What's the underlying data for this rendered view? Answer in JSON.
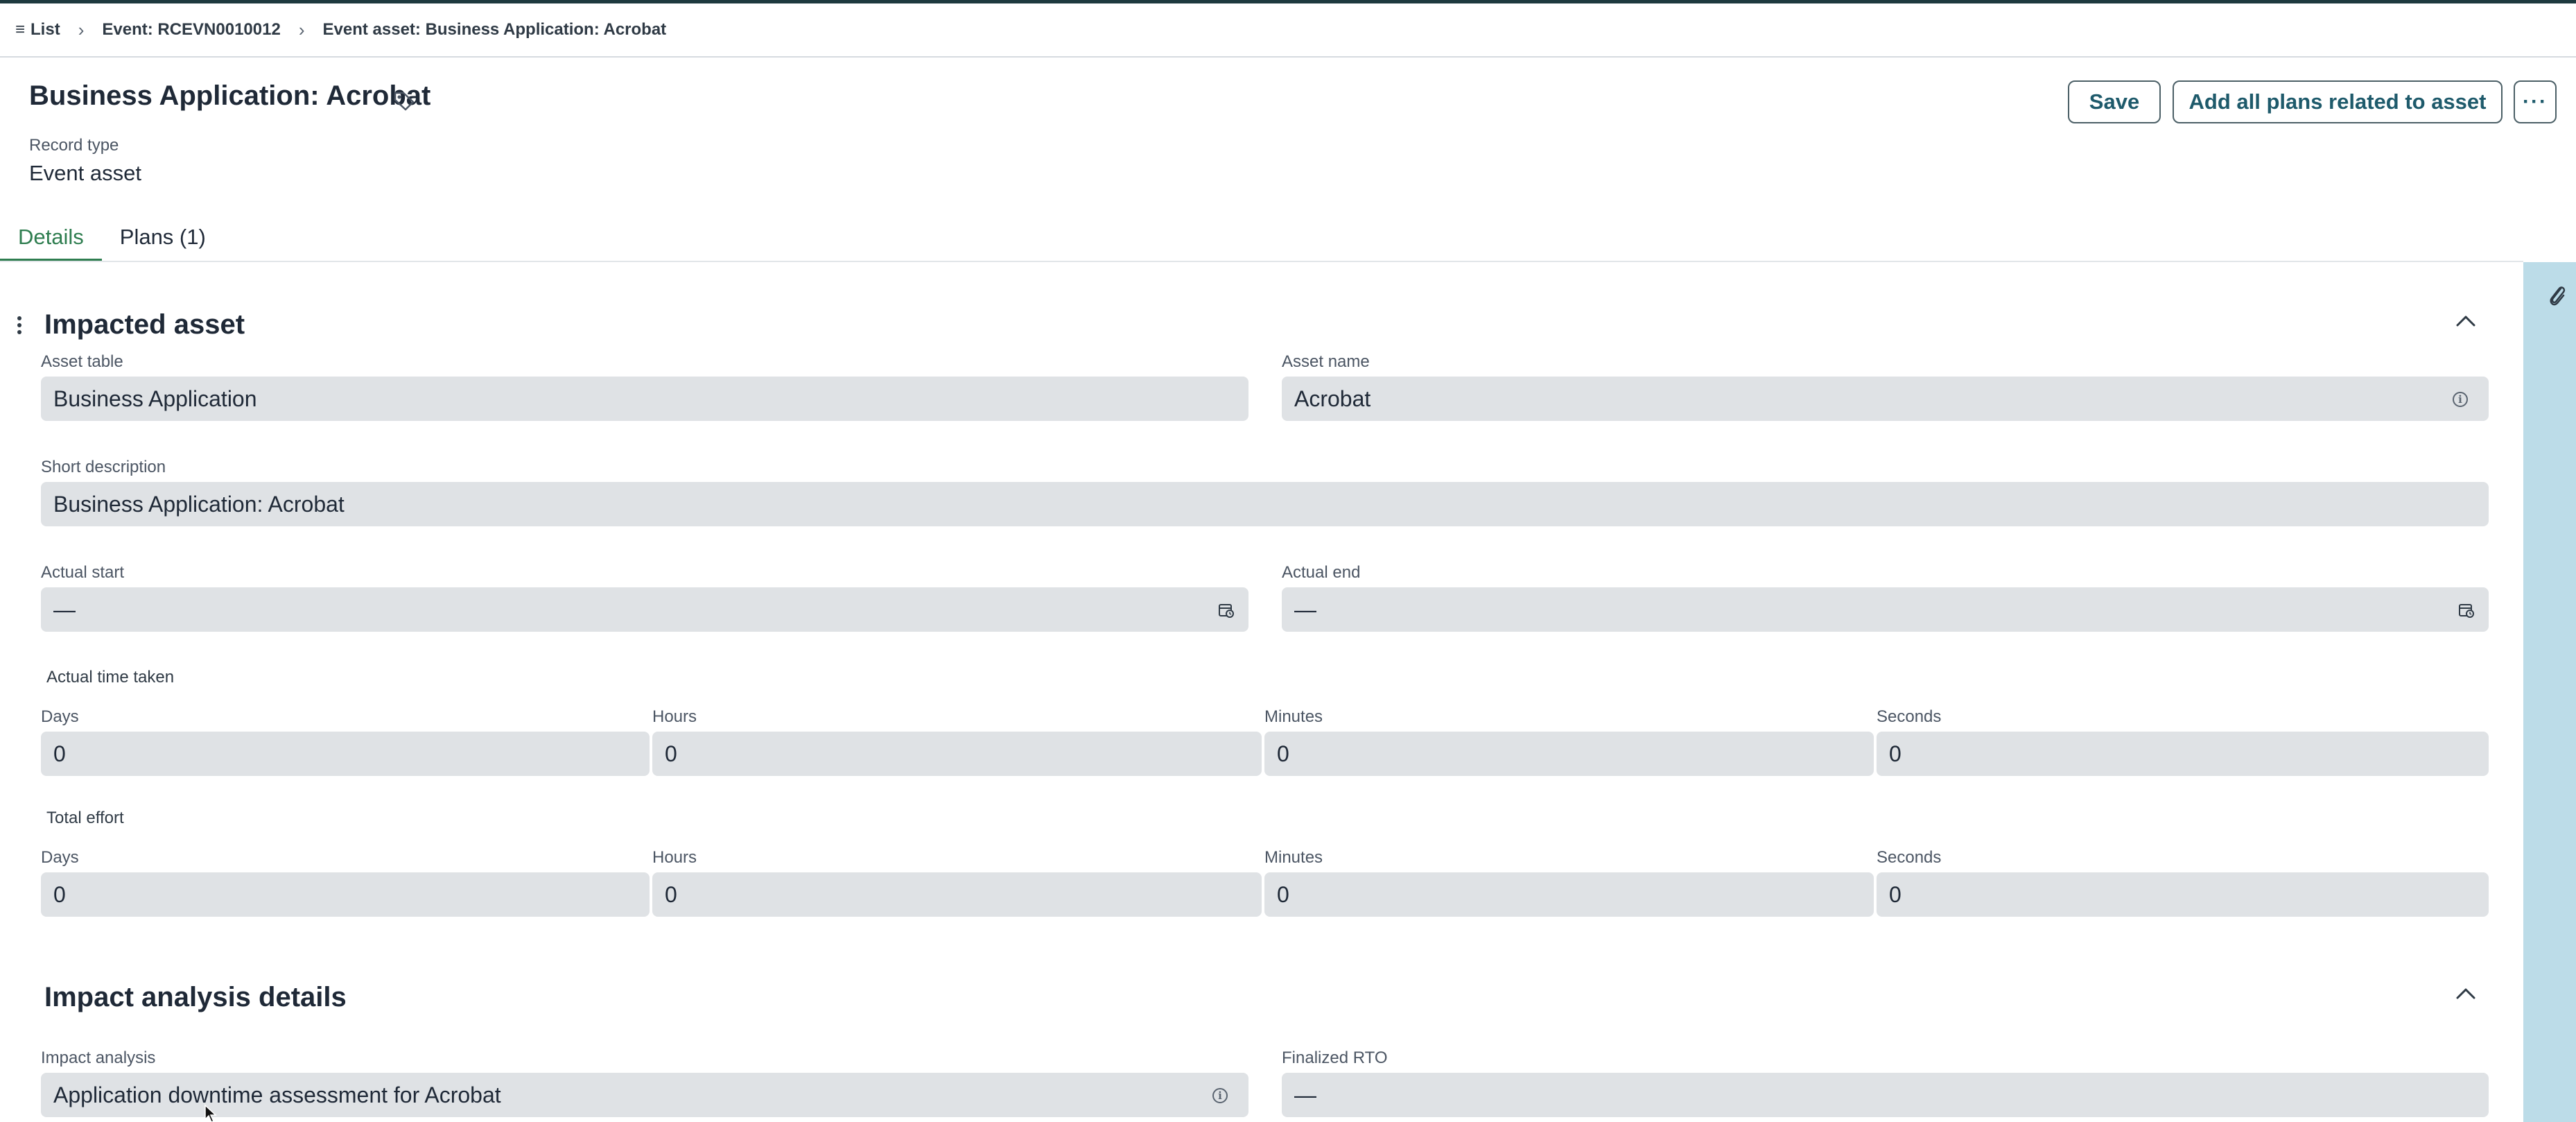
{
  "breadcrumb": {
    "list_label": "List",
    "event_label": "Event: RCEVN0010012",
    "current_label": "Event asset: Business Application: Acrobat"
  },
  "header": {
    "title": "Business Application: Acrobat",
    "record_type_label": "Record type",
    "record_type_value": "Event asset",
    "save_label": "Save",
    "add_plans_label": "Add all plans related to asset",
    "more_label": "···"
  },
  "tabs": [
    {
      "label": "Details",
      "active": true
    },
    {
      "label": "Plans (1)",
      "active": false
    }
  ],
  "impacted_asset": {
    "title": "Impacted asset",
    "asset_table": {
      "label": "Asset table",
      "value": "Business Application"
    },
    "asset_name": {
      "label": "Asset name",
      "value": "Acrobat"
    },
    "short_description": {
      "label": "Short description",
      "value": "Business Application: Acrobat"
    },
    "actual_start": {
      "label": "Actual start",
      "value": "—"
    },
    "actual_end": {
      "label": "Actual end",
      "value": "—"
    },
    "actual_time_taken": {
      "label": "Actual time taken",
      "days": {
        "label": "Days",
        "value": "0"
      },
      "hours": {
        "label": "Hours",
        "value": "0"
      },
      "minutes": {
        "label": "Minutes",
        "value": "0"
      },
      "seconds": {
        "label": "Seconds",
        "value": "0"
      }
    },
    "total_effort": {
      "label": "Total effort",
      "days": {
        "label": "Days",
        "value": "0"
      },
      "hours": {
        "label": "Hours",
        "value": "0"
      },
      "minutes": {
        "label": "Minutes",
        "value": "0"
      },
      "seconds": {
        "label": "Seconds",
        "value": "0"
      }
    }
  },
  "impact_analysis_details": {
    "title": "Impact analysis details",
    "impact_analysis": {
      "label": "Impact analysis",
      "value": "Application downtime assessment for Acrobat"
    },
    "finalized_rto": {
      "label": "Finalized RTO",
      "value": "—"
    }
  },
  "colors": {
    "accent": "#2e7d4f",
    "button_text": "#1e5a6b",
    "field_bg": "#dfe2e5",
    "side_rail": "#bcdce8"
  },
  "icons": {
    "menu": "list-menu-icon",
    "tag": "tag-icon",
    "attachment": "paperclip-icon",
    "calendar": "calendar-icon",
    "info": "info-icon",
    "collapse": "chevron-up-icon"
  }
}
